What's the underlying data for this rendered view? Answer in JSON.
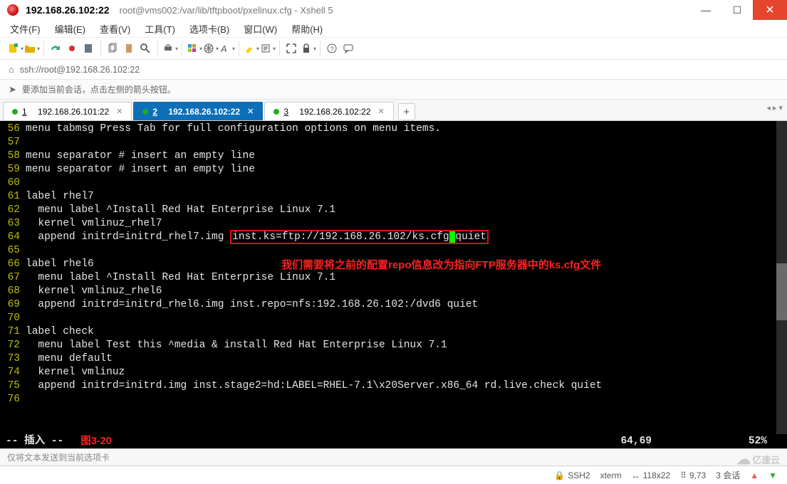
{
  "titlebar": {
    "title": "192.168.26.102:22",
    "path": "root@vms002:/var/lib/tftpboot/pxelinux.cfg - Xshell 5"
  },
  "menu": [
    "文件(F)",
    "编辑(E)",
    "查看(V)",
    "工具(T)",
    "选项卡(B)",
    "窗口(W)",
    "帮助(H)"
  ],
  "addressbar": {
    "url": "ssh://root@192.168.26.102:22"
  },
  "infobar": {
    "text": "要添加当前会话，点击左侧的箭头按钮。"
  },
  "tabs": [
    {
      "num": "1",
      "label": "192.168.26.101:22",
      "active": false
    },
    {
      "num": "2",
      "label": "192.168.26.102:22",
      "active": true
    },
    {
      "num": "3",
      "label": "192.168.26.102:22",
      "active": false
    }
  ],
  "terminal": {
    "lines": [
      {
        "ln": "56",
        "text": "menu tabmsg Press Tab for full configuration options on menu items."
      },
      {
        "ln": "57",
        "text": ""
      },
      {
        "ln": "58",
        "text": "menu separator # insert an empty line"
      },
      {
        "ln": "59",
        "text": "menu separator # insert an empty line"
      },
      {
        "ln": "60",
        "text": ""
      },
      {
        "ln": "61",
        "text": "label rhel7"
      },
      {
        "ln": "62",
        "text": "  menu label ^Install Red Hat Enterprise Linux 7.1"
      },
      {
        "ln": "63",
        "text": "  kernel vmlinuz_rhel7"
      },
      {
        "ln": "64",
        "pre": "  append initrd=initrd_rhel7.img ",
        "box": "inst.ks=ftp://192.168.26.102/ks.cfg",
        "cursor": " ",
        "post": "quiet"
      },
      {
        "ln": "65",
        "text": ""
      },
      {
        "ln": "66",
        "text": "label rhel6"
      },
      {
        "ln": "67",
        "text": "  menu label ^Install Red Hat Enterprise Linux 7.1"
      },
      {
        "ln": "68",
        "text": "  kernel vmlinuz_rhel6"
      },
      {
        "ln": "69",
        "text": "  append initrd=initrd_rhel6.img inst.repo=nfs:192.168.26.102:/dvd6 quiet"
      },
      {
        "ln": "70",
        "text": ""
      },
      {
        "ln": "71",
        "text": "label check"
      },
      {
        "ln": "72",
        "text": "  menu label Test this ^media & install Red Hat Enterprise Linux 7.1"
      },
      {
        "ln": "73",
        "text": "  menu default"
      },
      {
        "ln": "74",
        "text": "  kernel vmlinuz"
      },
      {
        "ln": "75",
        "text": "  append initrd=initrd.img inst.stage2=hd:LABEL=RHEL-7.1\\x20Server.x86_64 rd.live.check quiet"
      },
      {
        "ln": "76",
        "text": ""
      }
    ],
    "annotation": "我们需要将之前的配置repo信息改为指向FTP服务器中的ks.cfg文件",
    "status": {
      "mode": "-- 插入 --",
      "figlabel": "图3-20",
      "pos": "64,69",
      "pct": "52%"
    }
  },
  "compose": {
    "placeholder": "仅将文本发送到当前选项卡"
  },
  "statusbar": {
    "conn": "SSH2",
    "term": "xterm",
    "size": "118x22",
    "cursor": "9,73",
    "sessions": "3 会话",
    "logo": "亿速云"
  }
}
